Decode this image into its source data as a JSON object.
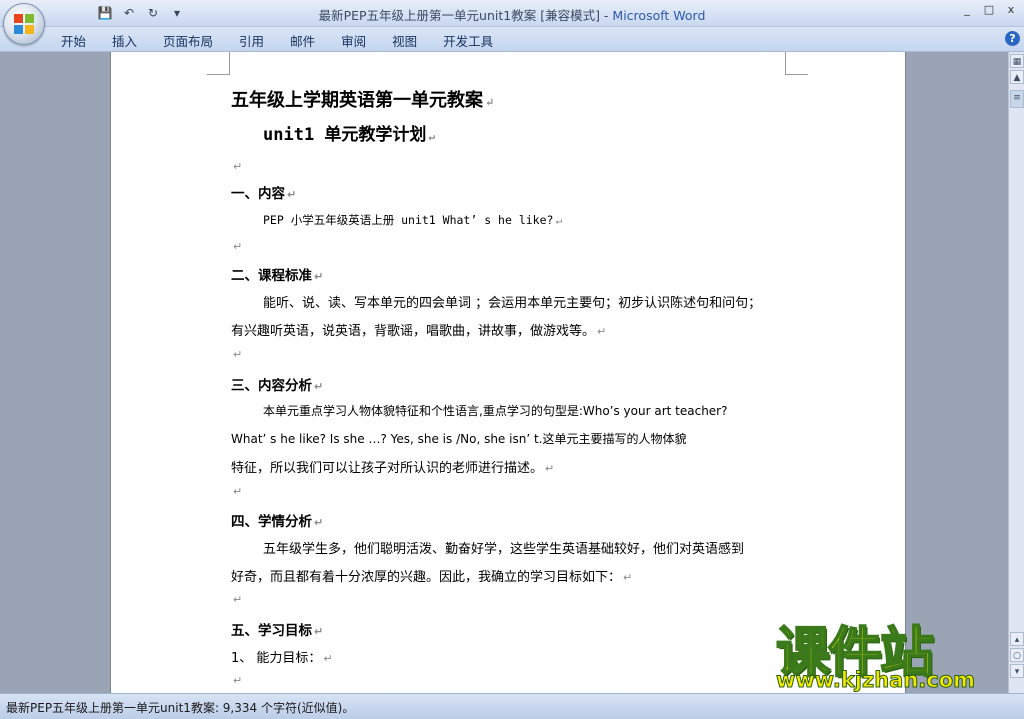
{
  "window": {
    "title": "最新PEP五年级上册第一单元unit1教案 [兼容模式] - ",
    "app_name": "Microsoft Word",
    "controls": [
      "_",
      "□",
      "x"
    ]
  },
  "qat": {
    "save": "💾",
    "undo": "↶",
    "redo": "↻",
    "more": "▾"
  },
  "ribbon": {
    "tabs": [
      "开始",
      "插入",
      "页面布局",
      "引用",
      "邮件",
      "审阅",
      "视图",
      "开发工具"
    ],
    "help": "?"
  },
  "document": {
    "title": "五年级上学期英语第一单元教案",
    "subtitle": "unit1  单元教学计划",
    "para_mark": "↵",
    "sections": {
      "s1_heading": "一、内容",
      "s1_text": "PEP 小学五年级英语上册 unit1  What’ s he like?",
      "s2_heading": "二、课程标准",
      "s2_line1": "能听、说、读、写本单元的四会单词 ；会运用本单元主要句；初步认识陈述句和问句；",
      "s2_line2": "有兴趣听英语，说英语，背歌谣，唱歌曲，讲故事，做游戏等。",
      "s3_heading": "三、内容分析",
      "s3_line1": "本单元重点学习人物体貌特征和个性语言,重点学习的句型是:Who’s your art teacher?",
      "s3_line2": "What’ s he like? Is she …? Yes, she is /No, she isn’ t.这单元主要描写的人物体貌",
      "s3_line3": "特征，所以我们可以让孩子对所认识的老师进行描述。",
      "s4_heading": "四、学情分析",
      "s4_line1": "五年级学生多，他们聪明活泼、勤奋好学，这些学生英语基础较好，他们对英语感到",
      "s4_line2": "好奇，而且都有着十分浓厚的兴趣。因此，我确立的学习目标如下：",
      "s5_heading": "五、学习目标",
      "s5_item1": "1、 能力目标："
    }
  },
  "statusbar": {
    "text": "最新PEP五年级上册第一单元unit1教案: 9,334 个字符(近似值)。"
  },
  "watermark": {
    "logo": "课件站",
    "url": "www.kjzhan.com"
  }
}
